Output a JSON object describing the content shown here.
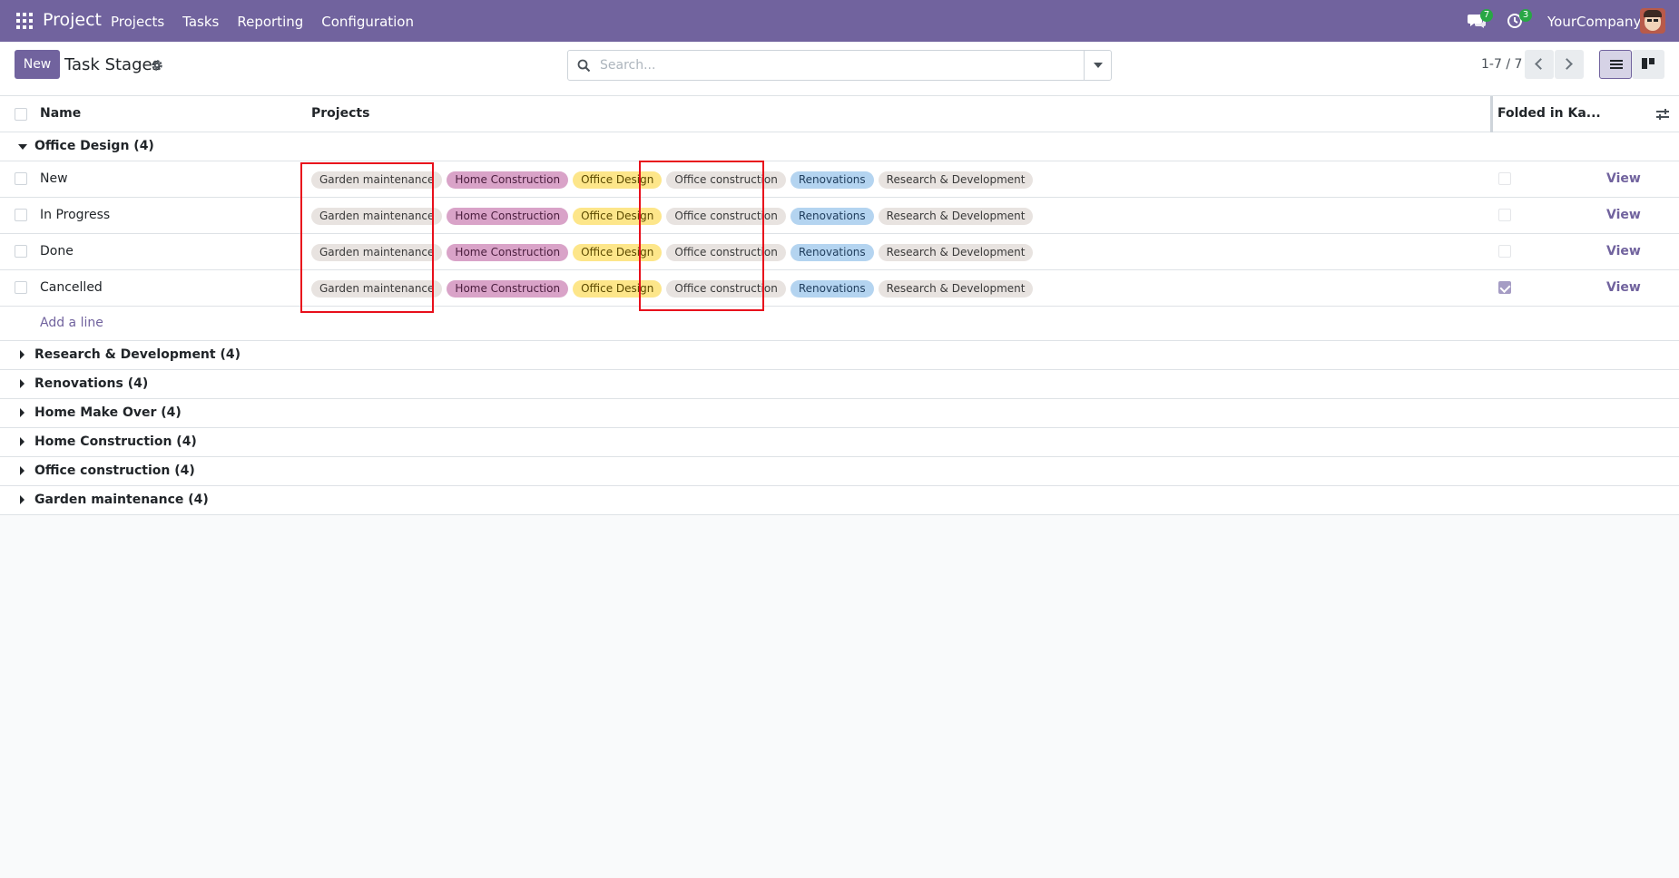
{
  "navbar": {
    "app_name": "Project",
    "menu": [
      "Projects",
      "Tasks",
      "Reporting",
      "Configuration"
    ],
    "messages_count": "7",
    "activities_count": "3",
    "company": "YourCompany"
  },
  "control": {
    "new_label": "New",
    "title": "Task Stages",
    "search_placeholder": "Search...",
    "pager": "1-7 / 7"
  },
  "table": {
    "col_name": "Name",
    "col_projects": "Projects",
    "col_folded": "Folded in Ka..."
  },
  "expanded_group": {
    "label": "Office Design (4)",
    "rows": [
      {
        "name": "New",
        "folded": false,
        "action": "View"
      },
      {
        "name": "In Progress",
        "folded": false,
        "action": "View"
      },
      {
        "name": "Done",
        "folded": false,
        "action": "View"
      },
      {
        "name": "Cancelled",
        "folded": true,
        "action": "View"
      }
    ],
    "add_line": "Add a line"
  },
  "project_tags": [
    {
      "label": "Garden maintenance",
      "bg": "#e8e3e0",
      "fg": "#3a3a3a"
    },
    {
      "label": "Home Construction",
      "bg": "#d9a3c8",
      "fg": "#4a1d3d"
    },
    {
      "label": "Office Design",
      "bg": "#fde68a",
      "fg": "#5c4a00"
    },
    {
      "label": "Office construction",
      "bg": "#e8e3e0",
      "fg": "#3a3a3a"
    },
    {
      "label": "Renovations",
      "bg": "#b4d4f0",
      "fg": "#1f3d5c"
    },
    {
      "label": "Research & Development",
      "bg": "#e8e3e0",
      "fg": "#3a3a3a"
    }
  ],
  "collapsed_groups": [
    "Research & Development (4)",
    "Renovations (4)",
    "Home Make Over (4)",
    "Home Construction (4)",
    "Office construction (4)",
    "Garden maintenance (4)"
  ],
  "colors": {
    "brand": "#71639e",
    "highlight": "#e8101c"
  }
}
